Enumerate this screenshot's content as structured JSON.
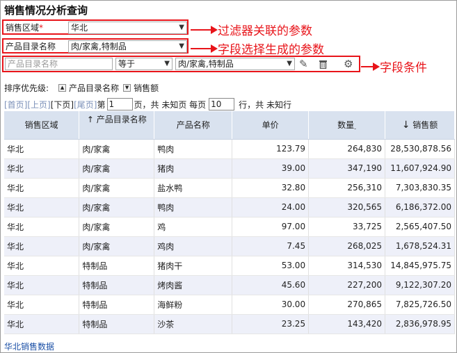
{
  "title": "销售情况分析查询",
  "filters": {
    "region": {
      "label": "销售区域",
      "required_mark": "*",
      "value": "华北"
    },
    "category": {
      "label": "产品目录名称",
      "value": "肉/家禽,特制品"
    }
  },
  "annotations": {
    "filter_param": "过滤器关联的参数",
    "field_param": "字段选择生成的参数",
    "field_condition": "字段条件"
  },
  "condition": {
    "field_placeholder": "产品目录名称",
    "operator": "等于",
    "value": "肉/家禽,特制品",
    "icons": [
      "pencil-icon",
      "trash-icon",
      "gear-icon"
    ]
  },
  "sort": {
    "label": "排序优先级:",
    "items": [
      {
        "icon": "sort-asc-icon",
        "label": "产品目录名称"
      },
      {
        "icon": "sort-desc-icon",
        "label": "销售额"
      }
    ]
  },
  "pager": {
    "first": "[首页]",
    "prev": "[上页]",
    "next": "[下页]",
    "last": "[尾页]",
    "page_prefix": "第",
    "page_value": "1",
    "page_suffix": "页，共 未知页 每页",
    "size_value": "10",
    "size_suffix": "行，共 未知行"
  },
  "table": {
    "columns": [
      "销售区域",
      "产品目录名称",
      "产品名称",
      "单价",
      "数量",
      "销售额"
    ],
    "sort_marks": {
      "category": "↑",
      "amount": "↓",
      "qty": "-"
    },
    "rows": [
      [
        "华北",
        "肉/家禽",
        "鸭肉",
        "123.79",
        "264,830",
        "28,530,878.56"
      ],
      [
        "华北",
        "肉/家禽",
        "猪肉",
        "39.00",
        "347,190",
        "11,607,924.90"
      ],
      [
        "华北",
        "肉/家禽",
        "盐水鸭",
        "32.80",
        "256,310",
        "7,303,830.35"
      ],
      [
        "华北",
        "肉/家禽",
        "鸭肉",
        "24.00",
        "320,565",
        "6,186,372.00"
      ],
      [
        "华北",
        "肉/家禽",
        "鸡",
        "97.00",
        "33,725",
        "2,565,407.50"
      ],
      [
        "华北",
        "肉/家禽",
        "鸡肉",
        "7.45",
        "268,025",
        "1,678,524.31"
      ],
      [
        "华北",
        "特制品",
        "猪肉干",
        "53.00",
        "314,530",
        "14,845,975.75"
      ],
      [
        "华北",
        "特制品",
        "烤肉酱",
        "45.60",
        "227,200",
        "9,122,307.20"
      ],
      [
        "华北",
        "特制品",
        "海鲜粉",
        "30.00",
        "270,865",
        "7,825,726.50"
      ],
      [
        "华北",
        "特制品",
        "沙茶",
        "23.25",
        "143,420",
        "2,836,978.95"
      ]
    ]
  },
  "footer_link": "华北销售数据",
  "colors": {
    "annotation": "#e8141a",
    "header_bg": "#d9e2ef",
    "row_alt": "#eef0f9",
    "link": "#1a4fa6"
  }
}
